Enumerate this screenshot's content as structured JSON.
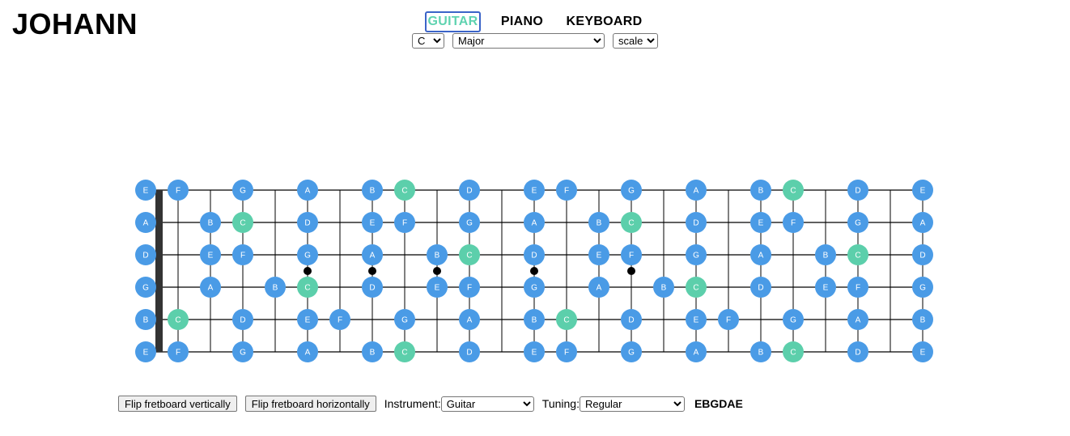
{
  "app": {
    "logo": "JOHANN"
  },
  "nav": {
    "items": [
      "GUITAR",
      "PIANO",
      "KEYBOARD"
    ],
    "active": "GUITAR"
  },
  "controls": {
    "key": "C",
    "mode": "Major",
    "view": "scale"
  },
  "colors": {
    "note": "#4a9be6",
    "root": "#5ccfab",
    "root_note": "C",
    "string": "#000000",
    "nut": "#333333"
  },
  "fretboard": {
    "frets": 24,
    "inlay_frets": [
      5,
      7,
      9,
      12,
      15
    ],
    "strings": [
      {
        "open": "E",
        "notes": [
          "E",
          "F",
          "",
          "G",
          "",
          "A",
          "",
          "B",
          "C",
          "",
          "D",
          "",
          "E",
          "F",
          "",
          "G",
          "",
          "A",
          "",
          "B",
          "C",
          "",
          "D",
          "",
          "E"
        ]
      },
      {
        "open": "A",
        "notes": [
          "A",
          "",
          "B",
          "C",
          "",
          "D",
          "",
          "E",
          "F",
          "",
          "G",
          "",
          "A",
          "",
          "B",
          "C",
          "",
          "D",
          "",
          "E",
          "F",
          "",
          "G",
          "",
          "A"
        ]
      },
      {
        "open": "D",
        "notes": [
          "D",
          "",
          "E",
          "F",
          "",
          "G",
          "",
          "A",
          "",
          "B",
          "C",
          "",
          "D",
          "",
          "E",
          "F",
          "",
          "G",
          "",
          "A",
          "",
          "B",
          "C",
          "",
          "D"
        ]
      },
      {
        "open": "G",
        "notes": [
          "G",
          "",
          "A",
          "",
          "B",
          "C",
          "",
          "D",
          "",
          "E",
          "F",
          "",
          "G",
          "",
          "A",
          "",
          "B",
          "C",
          "",
          "D",
          "",
          "E",
          "F",
          "",
          "G"
        ]
      },
      {
        "open": "B",
        "notes": [
          "B",
          "C",
          "",
          "D",
          "",
          "E",
          "F",
          "",
          "G",
          "",
          "A",
          "",
          "B",
          "C",
          "",
          "D",
          "",
          "E",
          "F",
          "",
          "G",
          "",
          "A",
          "",
          "B"
        ]
      },
      {
        "open": "E",
        "notes": [
          "E",
          "F",
          "",
          "G",
          "",
          "A",
          "",
          "B",
          "C",
          "",
          "D",
          "",
          "E",
          "F",
          "",
          "G",
          "",
          "A",
          "",
          "B",
          "C",
          "",
          "D",
          "",
          "E"
        ]
      }
    ]
  },
  "bottom": {
    "flip_vertical": "Flip fretboard vertically",
    "flip_horizontal": "Flip fretboard horizontally",
    "instrument_label": "Instrument:",
    "instrument": "Guitar",
    "tuning_label": "Tuning:",
    "tuning": "Regular",
    "tuning_notes": "EBGDAE"
  }
}
